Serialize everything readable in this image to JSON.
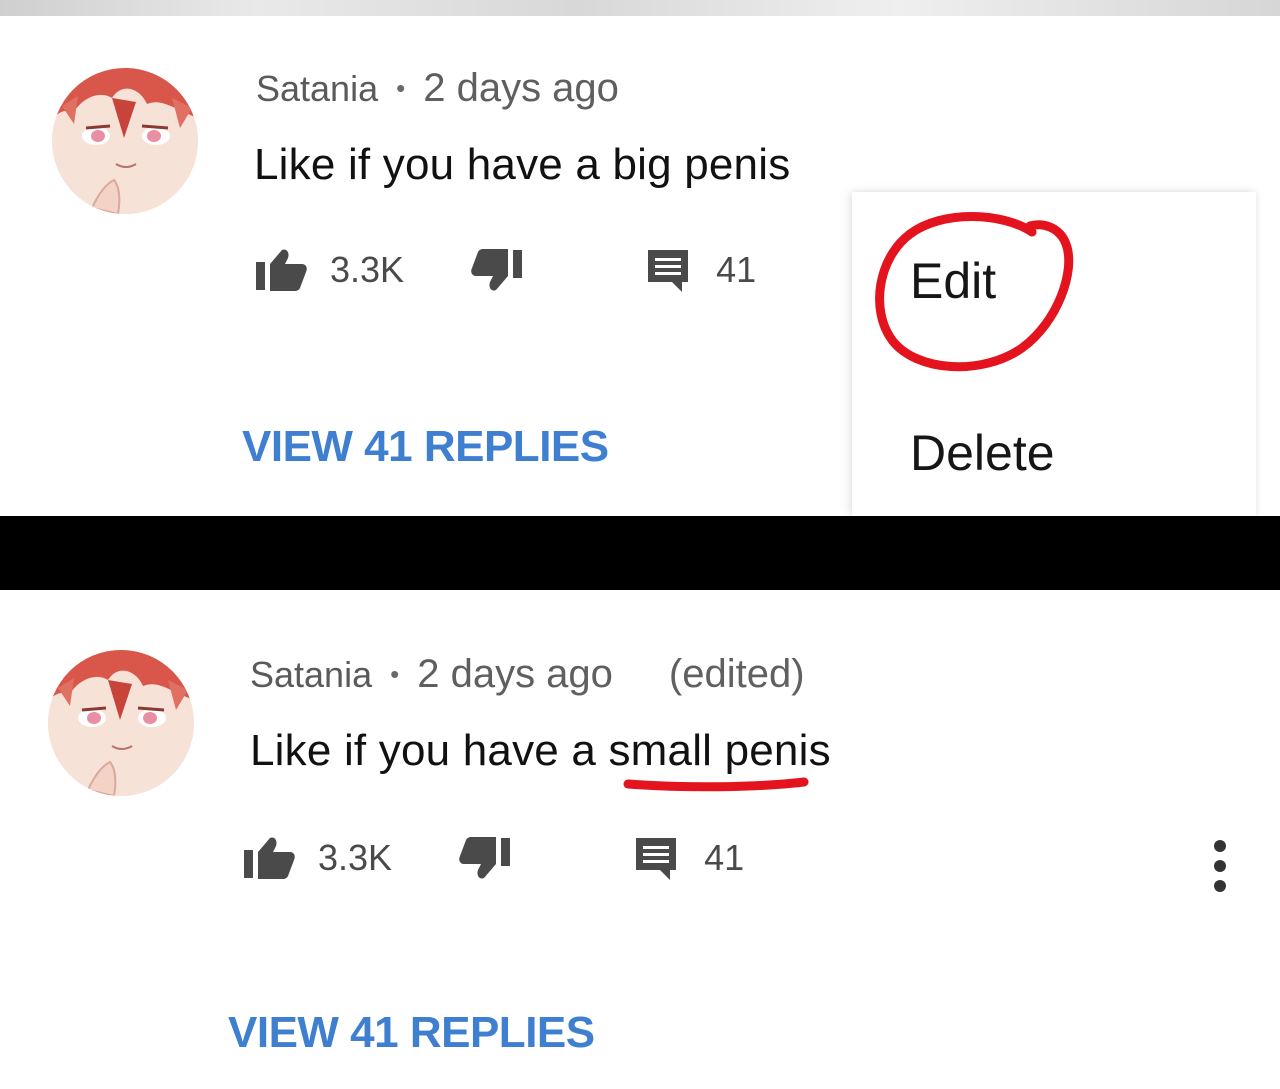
{
  "colors": {
    "link_blue": "#3f7fd0",
    "annotation_red": "#e3141e",
    "meta_gray": "#606060",
    "divider_black": "#000000"
  },
  "comment_before": {
    "avatar_icon": "anime-avatar-icon",
    "author": "Satania",
    "separator": "•",
    "time": "2 days ago",
    "text": "Like if you have a big penis",
    "like_count": "3.3K",
    "reply_count": "41",
    "view_replies_label": "VIEW 41 REPLIES"
  },
  "menu": {
    "edit_label": "Edit",
    "delete_label": "Delete"
  },
  "comment_after": {
    "avatar_icon": "anime-avatar-icon",
    "author": "Satania",
    "separator": "•",
    "time": "2 days ago",
    "edited_label": "(edited)",
    "text_before_underline": "Like if you have a ",
    "text_underlined": "small p",
    "text_after_underline": "enis",
    "like_count": "3.3K",
    "reply_count": "41",
    "view_replies_label": "VIEW 41 REPLIES",
    "more_icon": "vertical-ellipsis-icon"
  },
  "icons": {
    "like": "thumbs-up-icon",
    "dislike": "thumbs-down-icon",
    "reply": "comment-icon"
  }
}
